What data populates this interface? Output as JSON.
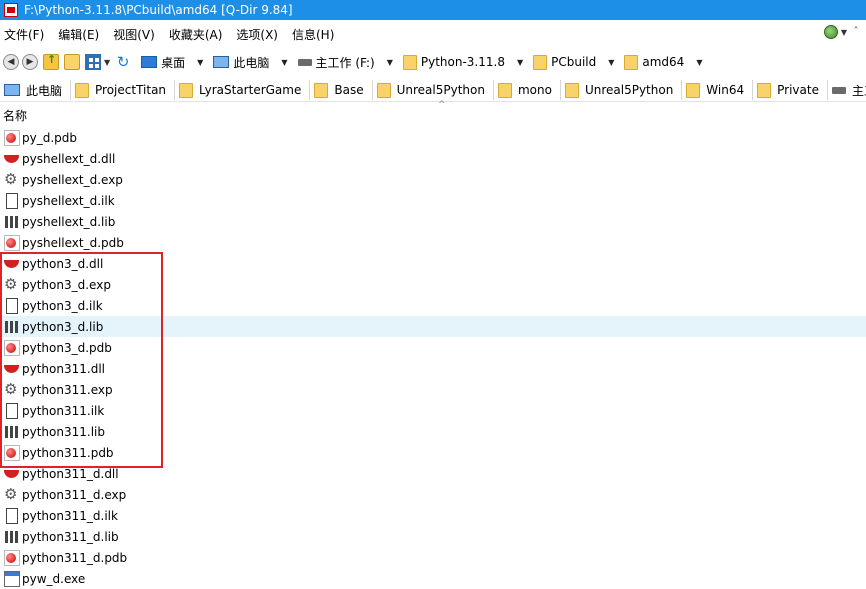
{
  "window": {
    "title": "F:\\Python-3.11.8\\PCbuild\\amd64  [Q-Dir 9.84]"
  },
  "menu": {
    "items": [
      "文件(F)",
      "编辑(E)",
      "视图(V)",
      "收藏夹(A)",
      "选项(X)",
      "信息(H)"
    ]
  },
  "address": {
    "crumbs": [
      {
        "label": "桌面",
        "icon": "desktop-icon"
      },
      {
        "label": "此电脑",
        "icon": "pc-icon"
      },
      {
        "label": "主工作 (F:)",
        "icon": "drive-icon"
      },
      {
        "label": "Python-3.11.8",
        "icon": "folder-icon"
      },
      {
        "label": "PCbuild",
        "icon": "folder-icon"
      },
      {
        "label": "amd64",
        "icon": "folder-icon"
      }
    ]
  },
  "favorites": [
    {
      "label": "此电脑",
      "icon": "pc-icon"
    },
    {
      "label": "ProjectTitan",
      "icon": "folder-icon"
    },
    {
      "label": "LyraStarterGame",
      "icon": "folder-icon"
    },
    {
      "label": "Base",
      "icon": "folder-icon"
    },
    {
      "label": "Unreal5Python",
      "icon": "folder-icon"
    },
    {
      "label": "mono",
      "icon": "folder-icon"
    },
    {
      "label": "Unreal5Python",
      "icon": "folder-icon"
    },
    {
      "label": "Win64",
      "icon": "folder-icon"
    },
    {
      "label": "Private",
      "icon": "folder-icon"
    },
    {
      "label": "主工作",
      "icon": "drive-icon"
    }
  ],
  "list": {
    "column_name": "名称",
    "files": [
      {
        "name": "py_d.pdb",
        "type": "pdb"
      },
      {
        "name": "pyshellext_d.dll",
        "type": "dll"
      },
      {
        "name": "pyshellext_d.exp",
        "type": "exp"
      },
      {
        "name": "pyshellext_d.ilk",
        "type": "ilk"
      },
      {
        "name": "pyshellext_d.lib",
        "type": "lib"
      },
      {
        "name": "pyshellext_d.pdb",
        "type": "pdb"
      },
      {
        "name": "python3_d.dll",
        "type": "dll"
      },
      {
        "name": "python3_d.exp",
        "type": "exp"
      },
      {
        "name": "python3_d.ilk",
        "type": "ilk"
      },
      {
        "name": "python3_d.lib",
        "type": "lib",
        "selected": true
      },
      {
        "name": "python3_d.pdb",
        "type": "pdb"
      },
      {
        "name": "python311.dll",
        "type": "dll"
      },
      {
        "name": "python311.exp",
        "type": "exp"
      },
      {
        "name": "python311.ilk",
        "type": "ilk"
      },
      {
        "name": "python311.lib",
        "type": "lib"
      },
      {
        "name": "python311.pdb",
        "type": "pdb"
      },
      {
        "name": "python311_d.dll",
        "type": "dll"
      },
      {
        "name": "python311_d.exp",
        "type": "exp"
      },
      {
        "name": "python311_d.ilk",
        "type": "ilk"
      },
      {
        "name": "python311_d.lib",
        "type": "lib"
      },
      {
        "name": "python311_d.pdb",
        "type": "pdb"
      },
      {
        "name": "pyw_d.exe",
        "type": "exe"
      }
    ]
  },
  "colors": {
    "titlebar": "#1e8fe6",
    "selection": "#e5f3fb",
    "highlight_box": "#e0222b"
  }
}
